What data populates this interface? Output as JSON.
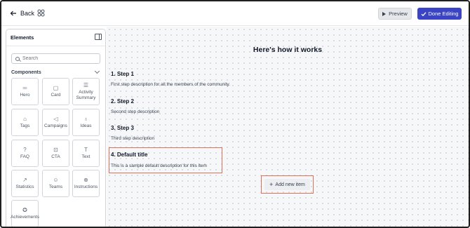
{
  "toolbar": {
    "back_label": "Back",
    "preview_label": "Preview",
    "done_label": "Done Editing",
    "accent_color": "#3b44c4"
  },
  "sidebar": {
    "title": "Elements",
    "search_placeholder": "Search",
    "section_label": "Components",
    "components": [
      {
        "label": "Hero",
        "icon": "hero-icon",
        "glyph": "═"
      },
      {
        "label": "Card",
        "icon": "card-icon",
        "glyph": "▢"
      },
      {
        "label": "Activity Summary",
        "icon": "activity-summary-icon",
        "glyph": "☰"
      },
      {
        "label": "Tags",
        "icon": "tag-icon",
        "glyph": "⌂"
      },
      {
        "label": "Campaigns",
        "icon": "megaphone-icon",
        "glyph": "◁"
      },
      {
        "label": "Ideas",
        "icon": "lightbulb-icon",
        "glyph": "♁"
      },
      {
        "label": "FAQ",
        "icon": "question-icon",
        "glyph": "?"
      },
      {
        "label": "CTA",
        "icon": "cta-icon",
        "glyph": "⊡"
      },
      {
        "label": "Text",
        "icon": "text-icon",
        "glyph": "T"
      },
      {
        "label": "Statistics",
        "icon": "trend-icon",
        "glyph": "↗"
      },
      {
        "label": "Teams",
        "icon": "team-icon",
        "glyph": "☺"
      },
      {
        "label": "Instructions",
        "icon": "globe-icon",
        "glyph": "⊕"
      },
      {
        "label": "Achievements",
        "icon": "achievement-icon",
        "glyph": "✪"
      }
    ]
  },
  "main": {
    "heading": "Here's how it works",
    "steps": [
      {
        "title": "1. Step 1",
        "description": "First step description for all the members of the community."
      },
      {
        "title": "2. Step 2",
        "description": "Second step description"
      },
      {
        "title": "3. Step 3",
        "description": "Third step description"
      },
      {
        "title": "4. Default title",
        "description": "This is a sample default description for this item"
      }
    ],
    "add_item_label": "Add new item"
  }
}
